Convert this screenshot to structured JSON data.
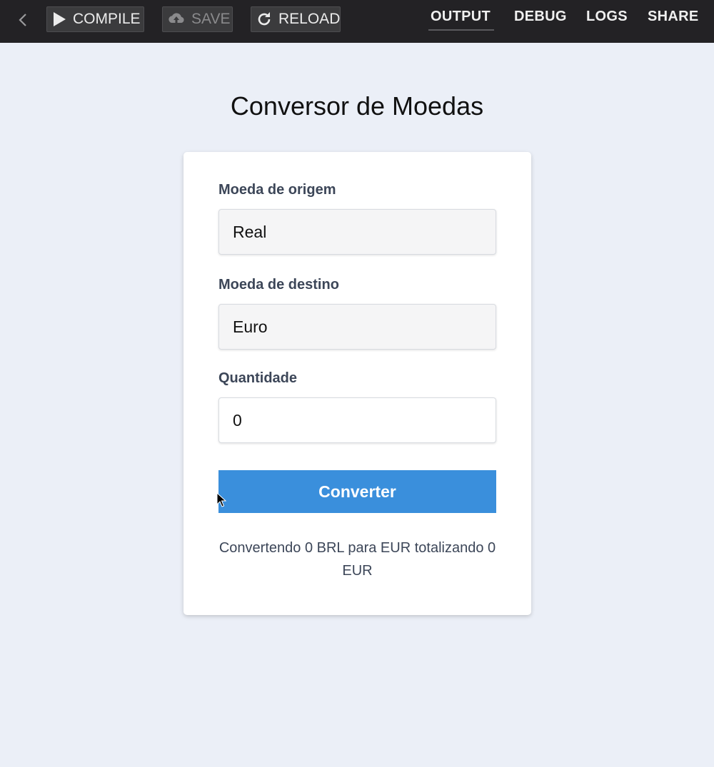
{
  "toolbar": {
    "compile_label": "COMPILE",
    "save_label": "SAVE",
    "reload_label": "RELOAD",
    "tabs": [
      {
        "label": "OUTPUT",
        "active": true
      },
      {
        "label": "DEBUG",
        "active": false
      },
      {
        "label": "LOGS",
        "active": false
      },
      {
        "label": "SHARE",
        "active": false
      }
    ],
    "icons": {
      "back": "chevron-left-icon",
      "compile": "play-icon",
      "save": "cloud-upload-icon",
      "reload": "refresh-icon"
    }
  },
  "app": {
    "title": "Conversor de Moedas",
    "origin_label": "Moeda de origem",
    "origin_value": "Real",
    "dest_label": "Moeda de destino",
    "dest_value": "Euro",
    "quantity_label": "Quantidade",
    "quantity_value": "0",
    "convert_label": "Converter",
    "result": "Convertendo 0 BRL para EUR totalizando 0 EUR"
  },
  "colors": {
    "toolbar_bg": "#232225",
    "page_bg": "#ebeff7",
    "button_accent": "#3a8fdc",
    "label_color": "#3c4658"
  }
}
